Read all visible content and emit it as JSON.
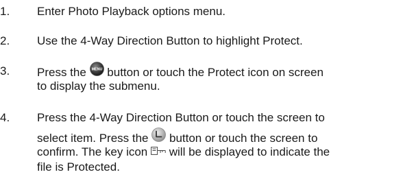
{
  "steps": [
    {
      "number": "1.",
      "text": "Enter Photo Playback options menu."
    },
    {
      "number": "2.",
      "text": "Use the 4-Way Direction Button to highlight Protect."
    },
    {
      "number": "3.",
      "line1_before": "Press the",
      "line1_after": "button or touch the Protect icon on screen",
      "line2": "to display the submenu.",
      "icon": "menu-button-icon",
      "icon_label": "MENU"
    },
    {
      "number": "4.",
      "line1": "Press the 4-Way Direction Button or touch the screen to",
      "line2_before": "select item. Press the",
      "line2_after": "button or touch the screen to",
      "line3_before": "confirm. The key icon",
      "line3_after": "will be displayed to indicate the",
      "line4": "file is Protected.",
      "icons": [
        "ok-button-icon",
        "key-icon"
      ]
    }
  ]
}
